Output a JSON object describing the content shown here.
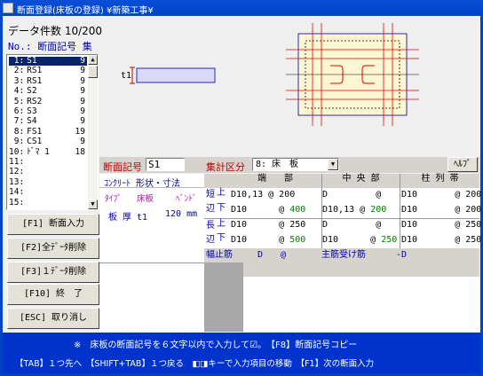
{
  "window": {
    "title": "断面登録(床板の登録) ¥新築工事¥"
  },
  "count": {
    "label": "データ件数",
    "value": "10/200"
  },
  "list": {
    "header": "No.: 断面記号 集",
    "items": [
      {
        "no": " 1:",
        "code": "S1",
        "num": "9"
      },
      {
        "no": " 2:",
        "code": "RS1",
        "num": "9"
      },
      {
        "no": " 3:",
        "code": "RS1",
        "num": "9"
      },
      {
        "no": " 4:",
        "code": "S2",
        "num": "9"
      },
      {
        "no": " 5:",
        "code": "RS2",
        "num": "9"
      },
      {
        "no": " 6:",
        "code": "S3",
        "num": "9"
      },
      {
        "no": " 7:",
        "code": "S4",
        "num": "9"
      },
      {
        "no": " 8:",
        "code": "FS1",
        "num": "19"
      },
      {
        "no": " 9:",
        "code": "CS1",
        "num": "9"
      },
      {
        "no": "10:",
        "code": "ﾄﾞﾏ 1",
        "num": "18"
      },
      {
        "no": "11:",
        "code": "",
        "num": ""
      },
      {
        "no": "12:",
        "code": "",
        "num": ""
      },
      {
        "no": "13:",
        "code": "",
        "num": ""
      },
      {
        "no": "14:",
        "code": "",
        "num": ""
      },
      {
        "no": "15:",
        "code": "",
        "num": ""
      }
    ]
  },
  "buttons": {
    "f1": "[F1] 断面入力",
    "f2": "[F2]全ﾃﾞｰﾀ削除",
    "f3": "[F3]１ﾃﾞｰﾀ削除",
    "f10": "[F10] 終　了",
    "esc": "[ESC] 取り消し",
    "help": "ﾍﾙﾌﾟ"
  },
  "diagram": {
    "t1_label": "t1"
  },
  "form": {
    "code_label": "断面記号",
    "code_value": "S1",
    "group_label": "集計区分",
    "group_value": "8: 床　板"
  },
  "concrete": {
    "header": "ｺﾝｸﾘｰﾄ 形状・寸法",
    "type_label": "ﾀｲﾌﾟ",
    "type_value": "床板",
    "bend_label": "ﾍﾞﾝﾄﾞ",
    "thick_label": "板 厚 t1",
    "thick_value": "120 mm"
  },
  "rebar": {
    "col_end": "端　　部",
    "col_center": "中 央 部",
    "col_col": "柱 列 帯",
    "short": "短\n辺",
    "long": "長\n辺",
    "upper": "上",
    "lower": "下",
    "rows": [
      {
        "end": "D10,13 @ 200",
        "center": "D         @",
        "col": "D10       @ 200"
      },
      {
        "end": "D10      @ 400",
        "center": "D10,13 @ 200",
        "col": "D10       @ 200"
      },
      {
        "end": "D10      @ 250",
        "center": "D         @",
        "col": "D10       @ 250"
      },
      {
        "end": "D10      @ 500",
        "center": "D10      @ 250",
        "col": "D10       @ 250"
      }
    ],
    "haba_label": "幅止筋",
    "haba_value": "D　　@",
    "main_label": "主筋受け筋",
    "main_value": "-D"
  },
  "status": {
    "line1": "※　床板の断面記号を６文字以内で入力して☑。　【F8】断面記号コピー",
    "line2": "【TAB】１つ先へ　【SHIFT+TAB】１つ戻る　◧◨キーで入力項目の移動　【F1】次の断面入力"
  },
  "colors": {
    "accent": "#0043c9",
    "red": "#c00000",
    "green": "#008000",
    "selection": "#0a246a"
  }
}
